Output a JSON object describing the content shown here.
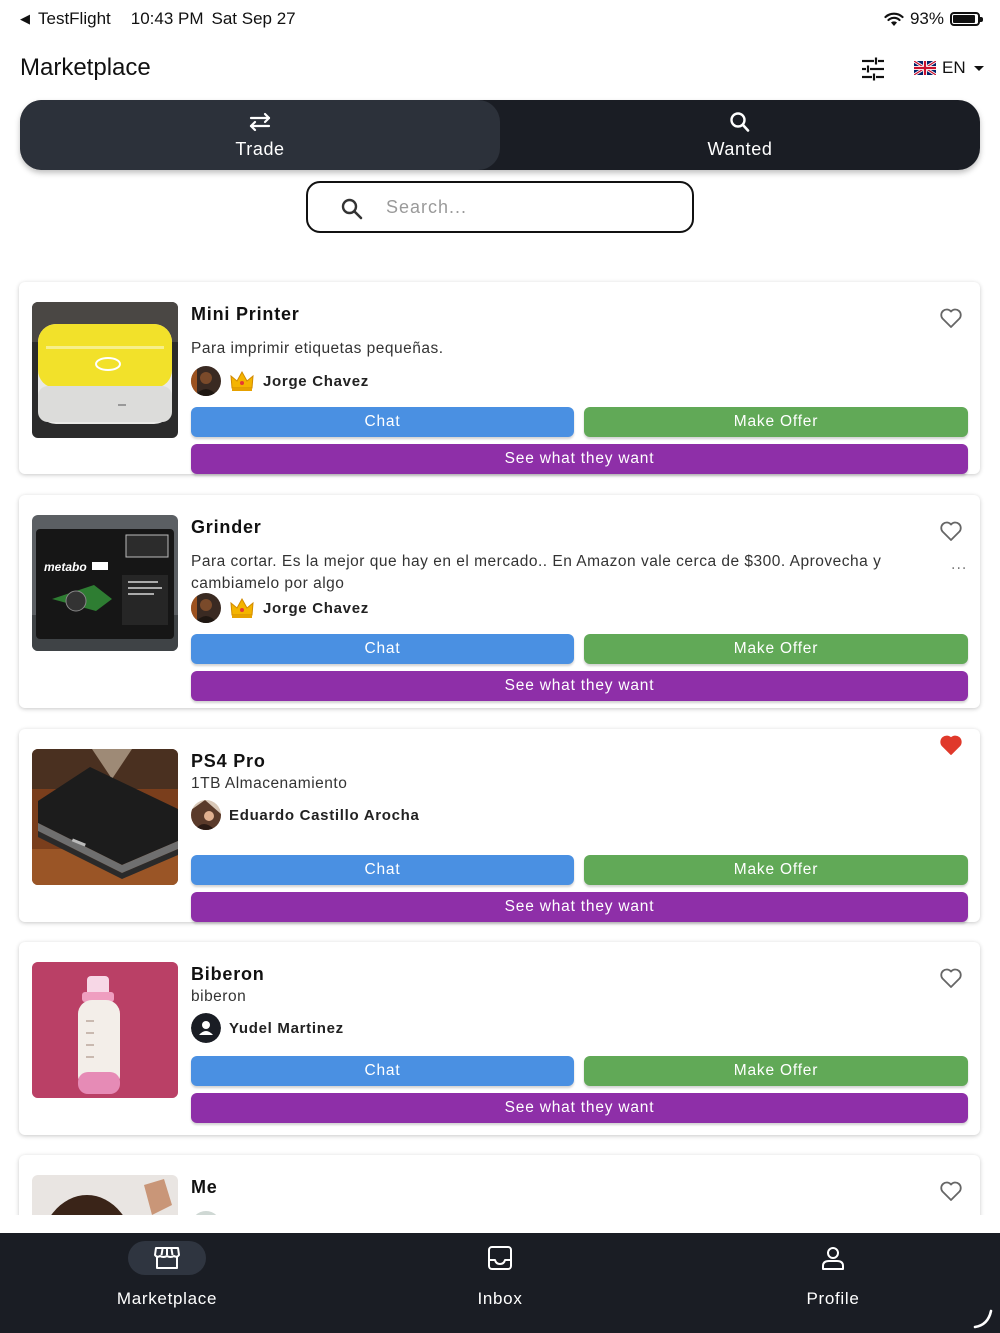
{
  "status_bar": {
    "back_app": "TestFlight",
    "time": "10:43 PM",
    "date": "Sat Sep 27",
    "battery": "93%",
    "battery_level": 0.93
  },
  "header": {
    "title": "Marketplace",
    "language": "EN",
    "filter_icon": "sliders-icon",
    "flag_icon": "uk-flag-icon"
  },
  "tabs": [
    {
      "label": "Trade",
      "icon": "swap-arrows-icon",
      "active": true
    },
    {
      "label": "Wanted",
      "icon": "search-icon",
      "active": false
    }
  ],
  "search": {
    "placeholder": "Search...",
    "value": ""
  },
  "listings": [
    {
      "title": "Mini Printer",
      "description": "Para imprimir etiquetas  pequeñas.",
      "owner": "Jorge Chavez",
      "owner_badge": "crown-icon",
      "favorited": false,
      "chat_label": "Chat",
      "offer_label": "Make Offer",
      "want_label": "See what they want"
    },
    {
      "title": "Grinder",
      "description": "Para cortar. Es la mejor que hay en el mercado.. En Amazon vale cerca de $300. Aprovecha y cambiamelo por algo",
      "owner": "Jorge Chavez",
      "owner_badge": "crown-icon",
      "favorited": false,
      "more": "...",
      "chat_label": "Chat",
      "offer_label": "Make Offer",
      "want_label": "See what they want"
    },
    {
      "title": "PS4 Pro",
      "description": "1TB Almacenamiento",
      "owner": "Eduardo Castillo Arocha",
      "favorited": true,
      "chat_label": "Chat",
      "offer_label": "Make Offer",
      "want_label": "See what they want"
    },
    {
      "title": "Biberon",
      "description": "biberon",
      "owner": "Yudel Martinez",
      "favorited": false,
      "chat_label": "Chat",
      "offer_label": "Make Offer",
      "want_label": "See what they want"
    },
    {
      "title": "Me",
      "favorited": false
    }
  ],
  "bottom_nav": [
    {
      "label": "Marketplace",
      "icon": "storefront-icon",
      "active": true
    },
    {
      "label": "Inbox",
      "icon": "inbox-icon",
      "active": false
    },
    {
      "label": "Profile",
      "icon": "person-icon",
      "active": false
    }
  ],
  "colors": {
    "chat": "#4a90e2",
    "make_offer": "#61a957",
    "see_what_they_want": "#8e2fa8",
    "dark_bar": "#1a1d24",
    "heart_active": "#e0392b"
  }
}
